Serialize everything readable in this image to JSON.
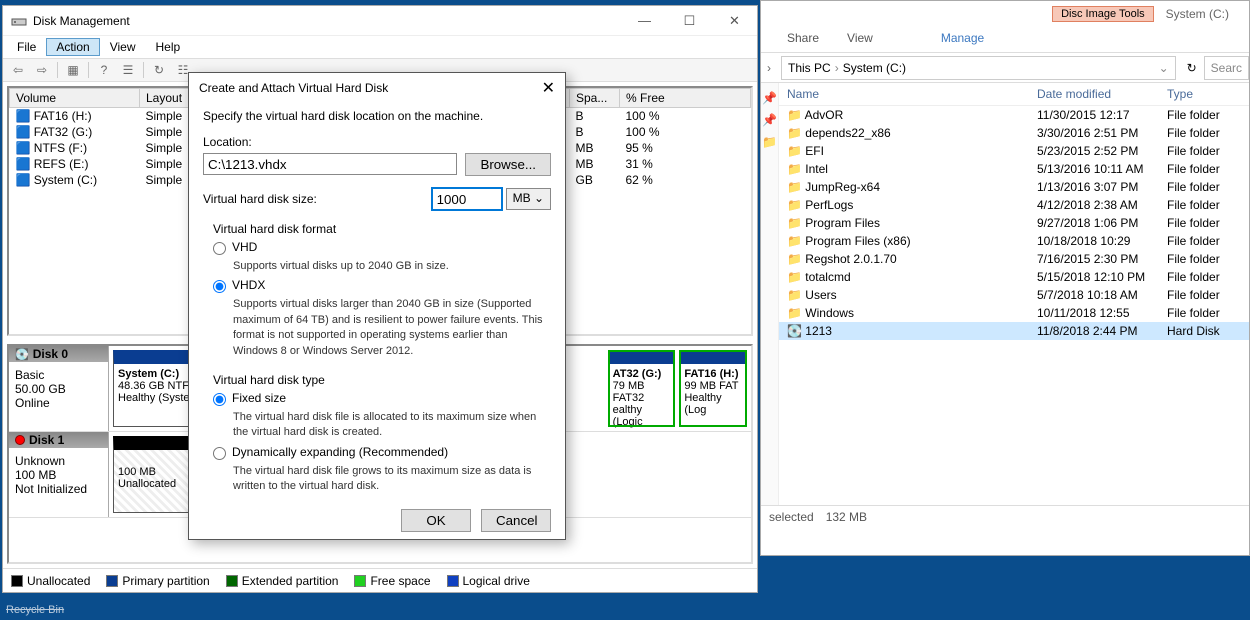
{
  "recycle_label": "Recycle Bin",
  "dm": {
    "title": "Disk Management",
    "menus": [
      "File",
      "Action",
      "View",
      "Help"
    ],
    "active_menu": "Action",
    "columns": [
      "Volume",
      "Layout",
      "Spa...",
      "% Free"
    ],
    "rows": [
      {
        "vol": "FAT16 (H:)",
        "layout": "Simple",
        "spa": "B",
        "free": "100 %"
      },
      {
        "vol": "FAT32 (G:)",
        "layout": "Simple",
        "spa": "B",
        "free": "100 %"
      },
      {
        "vol": "NTFS (F:)",
        "layout": "Simple",
        "spa": "MB",
        "free": "95 %"
      },
      {
        "vol": "REFS (E:)",
        "layout": "Simple",
        "spa": "MB",
        "free": "31 %"
      },
      {
        "vol": "System (C:)",
        "layout": "Simple",
        "spa": "GB",
        "free": "62 %"
      }
    ],
    "disk0": {
      "name": "Disk 0",
      "kind": "Basic",
      "size": "50.00 GB",
      "status": "Online",
      "vols": [
        {
          "name": "System (C:)",
          "sub1": "48.36 GB NTFS",
          "sub2": "Healthy (Syste"
        },
        {
          "name": "AT32 (G:)",
          "sub1": "79 MB FAT32",
          "sub2": "ealthy (Logic"
        },
        {
          "name": "FAT16 (H:)",
          "sub1": "99 MB FAT",
          "sub2": "Healthy (Log"
        }
      ]
    },
    "disk1": {
      "name": "Disk 1",
      "kind": "Unknown",
      "size": "100 MB",
      "status": "Not Initialized",
      "vols": [
        {
          "name": "",
          "sub1": "100 MB",
          "sub2": "Unallocated"
        }
      ]
    },
    "legend": [
      {
        "color": "#000",
        "label": "Unallocated"
      },
      {
        "color": "#0a3d91",
        "label": "Primary partition"
      },
      {
        "color": "#006600",
        "label": "Extended partition"
      },
      {
        "color": "#20d020",
        "label": "Free space"
      },
      {
        "color": "#1040c0",
        "label": "Logical drive"
      }
    ]
  },
  "dialog": {
    "title": "Create and Attach Virtual Hard Disk",
    "desc": "Specify the virtual hard disk location on the machine.",
    "location_label": "Location:",
    "location_value": "C:\\1213.vhdx",
    "browse": "Browse...",
    "size_label": "Virtual hard disk size:",
    "size_value": "1000",
    "unit": "MB",
    "fmt_label": "Virtual hard disk format",
    "vhd": "VHD",
    "vhd_sub": "Supports virtual disks up to 2040 GB in size.",
    "vhdx": "VHDX",
    "vhdx_sub": "Supports virtual disks larger than 2040 GB in size (Supported maximum of 64 TB) and is resilient to power failure events. This format is not supported in operating systems earlier than Windows 8 or Windows Server 2012.",
    "type_label": "Virtual hard disk type",
    "fixed": "Fixed size",
    "fixed_sub": "The virtual hard disk file is allocated to its maximum size when the virtual hard disk is created.",
    "dyn": "Dynamically expanding (Recommended)",
    "dyn_sub": "The virtual hard disk file grows to its maximum size as data is written to the virtual hard disk.",
    "ok": "OK",
    "cancel": "Cancel"
  },
  "explorer": {
    "context_tab": "Disc Image Tools",
    "title_text": "System (C:)",
    "ribbon": [
      "Share",
      "View",
      "Manage"
    ],
    "crumbs": [
      "This PC",
      "System (C:)"
    ],
    "search_ph": "Searc",
    "cols": [
      "Name",
      "Date modified",
      "Type"
    ],
    "items": [
      {
        "icon": "folder",
        "name": "AdvOR",
        "date": "11/30/2015 12:17",
        "type": "File folder"
      },
      {
        "icon": "folder",
        "name": "depends22_x86",
        "date": "3/30/2016 2:51 PM",
        "type": "File folder"
      },
      {
        "icon": "folder",
        "name": "EFI",
        "date": "5/23/2015 2:52 PM",
        "type": "File folder"
      },
      {
        "icon": "folder",
        "name": "Intel",
        "date": "5/13/2016 10:11 AM",
        "type": "File folder"
      },
      {
        "icon": "folder",
        "name": "JumpReg-x64",
        "date": "1/13/2016 3:07 PM",
        "type": "File folder"
      },
      {
        "icon": "folder",
        "name": "PerfLogs",
        "date": "4/12/2018 2:38 AM",
        "type": "File folder"
      },
      {
        "icon": "folder",
        "name": "Program Files",
        "date": "9/27/2018 1:06 PM",
        "type": "File folder"
      },
      {
        "icon": "folder",
        "name": "Program Files (x86)",
        "date": "10/18/2018 10:29",
        "type": "File folder"
      },
      {
        "icon": "folder",
        "name": "Regshot 2.0.1.70",
        "date": "7/16/2015 2:30 PM",
        "type": "File folder"
      },
      {
        "icon": "folder",
        "name": "totalcmd",
        "date": "5/15/2018 12:10 PM",
        "type": "File folder"
      },
      {
        "icon": "folder",
        "name": "Users",
        "date": "5/7/2018 10:18 AM",
        "type": "File folder"
      },
      {
        "icon": "folder",
        "name": "Windows",
        "date": "10/11/2018 12:55",
        "type": "File folder"
      },
      {
        "icon": "disk",
        "name": "1213",
        "date": "11/8/2018 2:44 PM",
        "type": "Hard Disk",
        "sel": true
      }
    ],
    "status_sel": "selected",
    "status_size": "132 MB"
  }
}
